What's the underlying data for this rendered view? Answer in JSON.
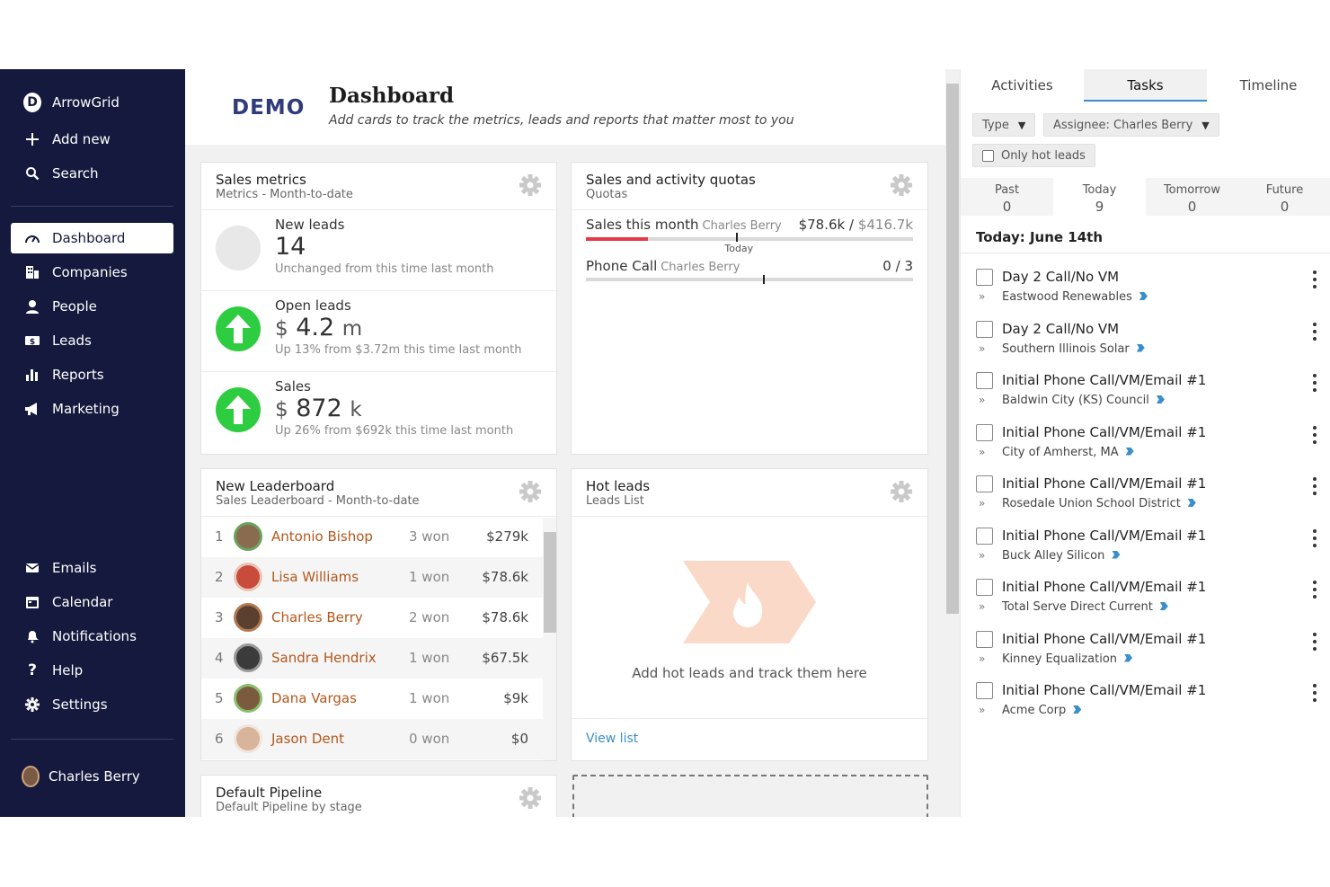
{
  "sidebar": {
    "brand": "ArrowGrid",
    "brand_letter": "D",
    "add_new": "Add new",
    "search": "Search",
    "items": [
      {
        "label": "Dashboard",
        "icon": "gauge-icon"
      },
      {
        "label": "Companies",
        "icon": "building-icon"
      },
      {
        "label": "People",
        "icon": "person-icon"
      },
      {
        "label": "Leads",
        "icon": "dollar-icon"
      },
      {
        "label": "Reports",
        "icon": "bar-chart-icon"
      },
      {
        "label": "Marketing",
        "icon": "megaphone-icon"
      }
    ],
    "bottom_items": [
      {
        "label": "Emails",
        "icon": "envelope-icon"
      },
      {
        "label": "Calendar",
        "icon": "calendar-icon"
      },
      {
        "label": "Notifications",
        "icon": "bell-icon"
      },
      {
        "label": "Help",
        "icon": "question-icon"
      },
      {
        "label": "Settings",
        "icon": "gear-icon"
      }
    ],
    "user": "Charles Berry"
  },
  "header": {
    "logo": "DEMO",
    "title": "Dashboard",
    "subtitle": "Add cards to track the metrics, leads and reports that matter most to you"
  },
  "sales_metrics": {
    "title": "Sales metrics",
    "subtitle": "Metrics - Month-to-date",
    "metrics": [
      {
        "label": "New leads",
        "value": "14",
        "currency": "",
        "unit": "",
        "desc": "Unchanged from this time last month",
        "trend": "neutral"
      },
      {
        "label": "Open leads",
        "value": "4.2",
        "currency": "$",
        "unit": "m",
        "desc": "Up 13% from $3.72m this time last month",
        "trend": "up"
      },
      {
        "label": "Sales",
        "value": "872",
        "currency": "$",
        "unit": "k",
        "desc": "Up 26% from $692k this time last month",
        "trend": "up"
      }
    ]
  },
  "quotas": {
    "title": "Sales and activity quotas",
    "subtitle": "Quotas",
    "today_label": "Today",
    "rows": [
      {
        "label": "Sales this month",
        "who": "Charles Berry",
        "current": "$78.6k",
        "sep": "/",
        "target": "$416.7k",
        "progress": 0.19,
        "today_marker": 0.46
      },
      {
        "label": "Phone Call",
        "who": "Charles Berry",
        "current": "0",
        "sep": "/",
        "target": "3",
        "progress": 0,
        "today_marker": 0.54
      }
    ],
    "colors": {
      "fill": "#e53948",
      "track": "#d9d9d9"
    }
  },
  "leaderboard": {
    "title": "New Leaderboard",
    "subtitle": "Sales Leaderboard - Month-to-date",
    "rows": [
      {
        "rank": "1",
        "name": "Antonio Bishop",
        "won": "3 won",
        "amount": "$279k"
      },
      {
        "rank": "2",
        "name": "Lisa Williams",
        "won": "1 won",
        "amount": "$78.6k"
      },
      {
        "rank": "3",
        "name": "Charles Berry",
        "won": "2 won",
        "amount": "$78.6k"
      },
      {
        "rank": "4",
        "name": "Sandra Hendrix",
        "won": "1 won",
        "amount": "$67.5k"
      },
      {
        "rank": "5",
        "name": "Dana Vargas",
        "won": "1 won",
        "amount": "$9k"
      },
      {
        "rank": "6",
        "name": "Jason Dent",
        "won": "0 won",
        "amount": "$0"
      }
    ]
  },
  "hot_leads": {
    "title": "Hot leads",
    "subtitle": "Leads List",
    "empty_text": "Add hot leads and track them here",
    "link": "View list"
  },
  "pipeline": {
    "title": "Default Pipeline",
    "subtitle": "Default Pipeline by stage"
  },
  "right_panel": {
    "tabs": [
      "Activities",
      "Tasks",
      "Timeline"
    ],
    "active_tab": "Tasks",
    "filters": {
      "type": "Type",
      "assignee": "Assignee: Charles Berry",
      "hot_only": "Only hot leads"
    },
    "periods": [
      {
        "label": "Past",
        "count": "0"
      },
      {
        "label": "Today",
        "count": "9"
      },
      {
        "label": "Tomorrow",
        "count": "0"
      },
      {
        "label": "Future",
        "count": "0"
      }
    ],
    "today_heading": "Today: June 14th",
    "tasks": [
      {
        "title": "Day 2 Call/No VM",
        "org": "Eastwood Renewables"
      },
      {
        "title": "Day 2 Call/No VM",
        "org": "Southern Illinois Solar"
      },
      {
        "title": "Initial Phone Call/VM/Email #1",
        "org": "Baldwin City (KS) Council"
      },
      {
        "title": "Initial Phone Call/VM/Email #1",
        "org": "City of Amherst, MA"
      },
      {
        "title": "Initial Phone Call/VM/Email #1",
        "org": "Rosedale Union School District"
      },
      {
        "title": "Initial Phone Call/VM/Email #1",
        "org": "Buck Alley Silicon"
      },
      {
        "title": "Initial Phone Call/VM/Email #1",
        "org": "Total Serve Direct Current"
      },
      {
        "title": "Initial Phone Call/VM/Email #1",
        "org": "Kinney Equalization"
      },
      {
        "title": "Initial Phone Call/VM/Email #1",
        "org": "Acme Corp"
      }
    ]
  },
  "colors": {
    "sidebar": "#14193d",
    "accent": "#3a8ecb",
    "link": "#b3571b",
    "up": "#2ecc40",
    "quota_bar": "#e53948"
  }
}
